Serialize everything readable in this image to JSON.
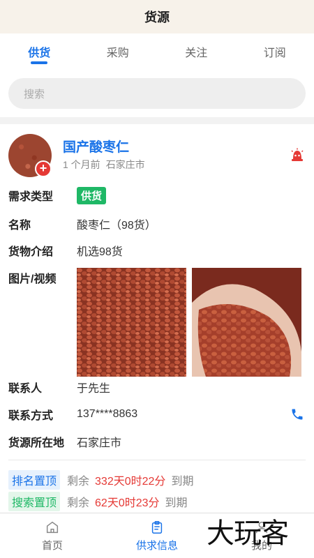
{
  "header": {
    "title": "货源"
  },
  "tabs": [
    {
      "label": "供货",
      "active": true
    },
    {
      "label": "采购",
      "active": false
    },
    {
      "label": "关注",
      "active": false
    },
    {
      "label": "订阅",
      "active": false
    }
  ],
  "search": {
    "placeholder": "搜索"
  },
  "listing": {
    "title": "国产酸枣仁",
    "time": "1 个月前",
    "location": "石家庄市",
    "fields": {
      "demand_type": {
        "label": "需求类型",
        "value": "供货"
      },
      "name": {
        "label": "名称",
        "value": "酸枣仁（98货）"
      },
      "intro": {
        "label": "货物介绍",
        "value": "机选98货"
      },
      "media": {
        "label": "图片/视频"
      },
      "contact_person": {
        "label": "联系人",
        "value": "于先生"
      },
      "contact_method": {
        "label": "联系方式",
        "value": "137****8863"
      },
      "origin": {
        "label": "货源所在地",
        "value": "石家庄市"
      }
    },
    "promotions": [
      {
        "tag": "排名置顶",
        "prefix": "剩余",
        "remaining": "332天0时22分",
        "suffix": "到期",
        "color": "#1a73e8"
      },
      {
        "tag": "搜索置顶",
        "prefix": "剩余",
        "remaining": "62天0时23分",
        "suffix": "到期",
        "color": "#1fb866"
      }
    ]
  },
  "bottom_nav": [
    {
      "label": "首页",
      "icon": "home-icon",
      "active": false
    },
    {
      "label": "供求信息",
      "icon": "clipboard-icon",
      "active": true
    },
    {
      "label": "我的",
      "icon": "user-icon",
      "active": false
    }
  ],
  "watermark": "大玩客",
  "colors": {
    "accent": "#1a73e8",
    "green": "#1fb866",
    "red": "#e53935",
    "header_bg": "#f7f2ea"
  }
}
